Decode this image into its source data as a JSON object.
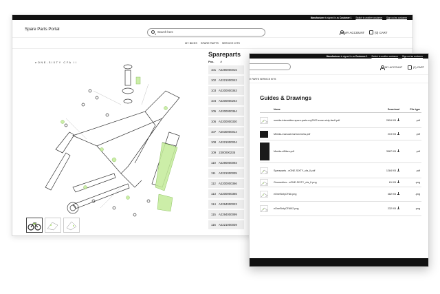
{
  "window_main": {
    "topbar": {
      "role": "Manufacturer",
      "signed_in_text": "is signed in as",
      "customer": "Customer 1",
      "switch_link": "Switch to another customer",
      "sign_out_link": "Sign out as customer"
    },
    "logo": "Spare Parts Portal",
    "search_placeholder": "Search here",
    "account_label": "MY ACCOUNT",
    "cart_label": "(0) CART",
    "nav": [
      "MY BIKES",
      "SPARE PARTS",
      "SERVICE KITS"
    ],
    "drawing_title": "eONE-SIXTY CFA II",
    "spareparts": {
      "title": "Spareparts",
      "col_pos": "Pos.",
      "col_num": "#",
      "rows": [
        {
          "pos": "101",
          "num": "A2290000015"
        },
        {
          "pos": "102",
          "num": "A2221000043"
        },
        {
          "pos": "103",
          "num": "A2200000363"
        },
        {
          "pos": "104",
          "num": "A2200000264"
        },
        {
          "pos": "105",
          "num": "A2200000364"
        },
        {
          "pos": "106",
          "num": "A2200000330"
        },
        {
          "pos": "107",
          "num": "A2030000014"
        },
        {
          "pos": "108",
          "num": "A2221000034"
        },
        {
          "pos": "109",
          "num": "2300000235"
        },
        {
          "pos": "110",
          "num": "A2290000093"
        },
        {
          "pos": "111",
          "num": "A2221000035"
        },
        {
          "pos": "112",
          "num": "A2200000366"
        },
        {
          "pos": "113",
          "num": "A2200000365"
        },
        {
          "pos": "114",
          "num": "A2294000023"
        },
        {
          "pos": "115",
          "num": "A2294000099"
        },
        {
          "pos": "116",
          "num": "A2221000039"
        }
      ]
    }
  },
  "window_guides": {
    "topbar": {
      "role": "Manufacturer",
      "signed_in_text": "is signed in as",
      "customer": "Customer 1",
      "switch_link": "Switch to another customer",
      "sign_out_link": "Sign out as customer"
    },
    "account_label": "MY ACCOUNT",
    "cart_label": "(0) CART",
    "nav_text": "E PARTS   SERVICE KITS",
    "title": "Guides & Drawings",
    "columns": {
      "name": "Name",
      "download": "Download",
      "filetype": "File type"
    },
    "files": [
      {
        "icon": "bike-drawing-thumb",
        "name": "merida-interaktive-spare-parts-my2022-eone-sixty-iiscfl.pdf",
        "size": "2816 KB",
        "type": ".pdf"
      },
      {
        "icon": "dark-doc-thumb",
        "name": "Merida-manual-Carbon-forks.pdf",
        "size": "219 KB",
        "type": ".pdf"
      },
      {
        "icon": "dark-book-thumb",
        "name": "Merida-eBikes.pdf",
        "size": "3587 KB",
        "type": ".pdf"
      },
      {
        "icon": "bike-drawing-thumb",
        "name": "Spareparts - eONE-SIXTY_cfa_II.pdf",
        "size": "1284 KB",
        "type": ".pdf"
      },
      {
        "icon": "geometry-thumb",
        "name": "Geometries - eONE-SIXTY_cfa_II.png",
        "size": "61 KB",
        "type": ".png"
      },
      {
        "icon": "bike-drawing-thumb",
        "name": "eOneSixtyCFAII.png",
        "size": "482 KB",
        "type": ".png"
      },
      {
        "icon": "bike-drawing-thumb",
        "name": "eOneSixtyCFAIII2.png",
        "size": "232 KB",
        "type": ".png"
      }
    ]
  },
  "colors": {
    "accent_green": "#a8e26b",
    "topbar": "#111111",
    "row_bg": "#eeeeee"
  }
}
